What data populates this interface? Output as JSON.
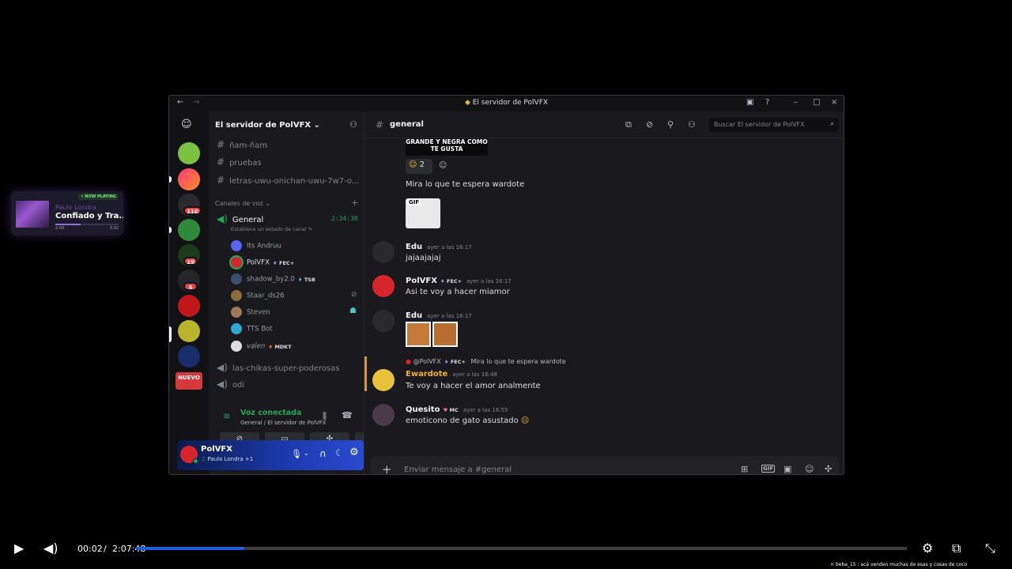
{
  "now_playing": {
    "badge": "• NOW PLAYING",
    "artist": "Paulo Londra",
    "song": "Confiado y Tra...",
    "time_current": "2:00",
    "time_total": "3:32",
    "progress": 0.4
  },
  "window": {
    "title": "El servidor de PolVFX"
  },
  "rail": {
    "mentions": [
      "110",
      "19",
      "6",
      "NUEVO"
    ]
  },
  "server": {
    "name": "El servidor de PolVFX",
    "text_channels": [
      "ñam-ñam",
      "pruebas",
      "letras-uwu-onichan-uwu-7w7-o..."
    ],
    "voice_category": "Canales de voz",
    "voice_channel": {
      "name": "General",
      "timer": "2:34:30",
      "status": "Establece un estado de canal"
    },
    "voice_users": [
      {
        "name": "Its Andruu",
        "tag": ""
      },
      {
        "name": "PolVFX",
        "tag": "FEC+"
      },
      {
        "name": "shadow_by2.0",
        "tag": "TSB"
      },
      {
        "name": "Staar_ds26",
        "tag": ""
      },
      {
        "name": "Steven",
        "tag": ""
      },
      {
        "name": "TTS Bot",
        "tag": ""
      },
      {
        "name": "valen",
        "tag": "MDKT"
      }
    ],
    "other_voice": [
      "las-chikas-super-poderosas",
      "odi"
    ]
  },
  "voice_connected": {
    "title": "Voz conectada",
    "sub": "General / El servidor de PolVFX"
  },
  "user": {
    "name": "PolVFX",
    "activity": "Paulo Londra +1"
  },
  "channel": {
    "name": "general",
    "search_placeholder": "Buscar El servidor de PolVFX",
    "composer_placeholder": "Enviar mensaje a #general"
  },
  "messages": {
    "sticker_text": "GRANDE Y NEGRA COMO TE GUSTA",
    "reaction_count": "2",
    "m0_text": "Mira lo que te espera wardote",
    "gif_label": "GIF",
    "m1": {
      "author": "Edu",
      "time": "ayer a las 16:17",
      "text": "jajaajajaj"
    },
    "m2": {
      "author": "PolVFX",
      "tag": "FEC+",
      "time": "ayer a las 16:17",
      "text": "Asi te voy a hacer miamor"
    },
    "m3": {
      "author": "Edu",
      "time": "ayer a las 16:17"
    },
    "m4": {
      "reply_author": "@PolVFX",
      "reply_tag": "FEC+",
      "reply_text": "Mira lo que te espera wardote",
      "author": "Ewardote",
      "time": "ayer a las 16:48",
      "text": "Te voy a hacer el amor analmente"
    },
    "m5": {
      "author": "Quesito",
      "tag": "MC",
      "time": "ayer a las 16:55",
      "text": "emoticono de gato asustado"
    }
  },
  "video": {
    "current": "00:02",
    "separator": "/",
    "total": "2:07:48",
    "progress": 0.14,
    "ticker": "beba_15 : acá venden muchas de esas y cosas de coco"
  }
}
